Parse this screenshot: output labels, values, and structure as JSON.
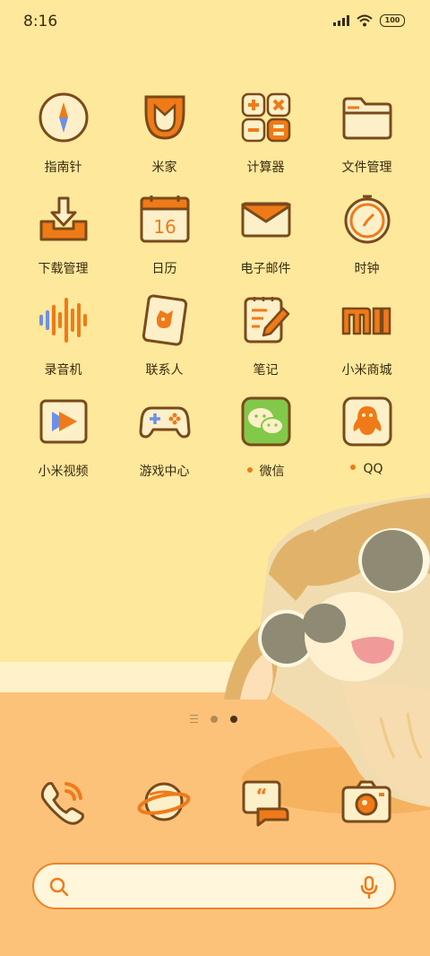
{
  "status_bar": {
    "time": "8:16",
    "battery": "100"
  },
  "apps": [
    {
      "id": "compass",
      "label": "指南针",
      "badge": false
    },
    {
      "id": "mijia",
      "label": "米家",
      "badge": false
    },
    {
      "id": "calculator",
      "label": "计算器",
      "badge": false
    },
    {
      "id": "file-manager",
      "label": "文件管理",
      "badge": false
    },
    {
      "id": "downloads",
      "label": "下载管理",
      "badge": false
    },
    {
      "id": "calendar",
      "label": "日历",
      "badge": false,
      "date": "16"
    },
    {
      "id": "email",
      "label": "电子邮件",
      "badge": false
    },
    {
      "id": "clock",
      "label": "时钟",
      "badge": false
    },
    {
      "id": "recorder",
      "label": "录音机",
      "badge": false
    },
    {
      "id": "contacts",
      "label": "联系人",
      "badge": false
    },
    {
      "id": "notes",
      "label": "笔记",
      "badge": false
    },
    {
      "id": "mi-store",
      "label": "小米商城",
      "badge": false
    },
    {
      "id": "mi-video",
      "label": "小米视频",
      "badge": false
    },
    {
      "id": "game-center",
      "label": "游戏中心",
      "badge": false
    },
    {
      "id": "wechat",
      "label": "微信",
      "badge": true
    },
    {
      "id": "qq",
      "label": "QQ",
      "badge": true
    }
  ],
  "pager": {
    "pages": 2,
    "current": 2
  },
  "dock": [
    "phone-icon",
    "browser-icon",
    "messages-icon",
    "camera-icon"
  ],
  "colors": {
    "accent": "#f07a18",
    "brown": "#7a4a1a",
    "cream": "#fdf0c8",
    "background": "#fde89c"
  }
}
